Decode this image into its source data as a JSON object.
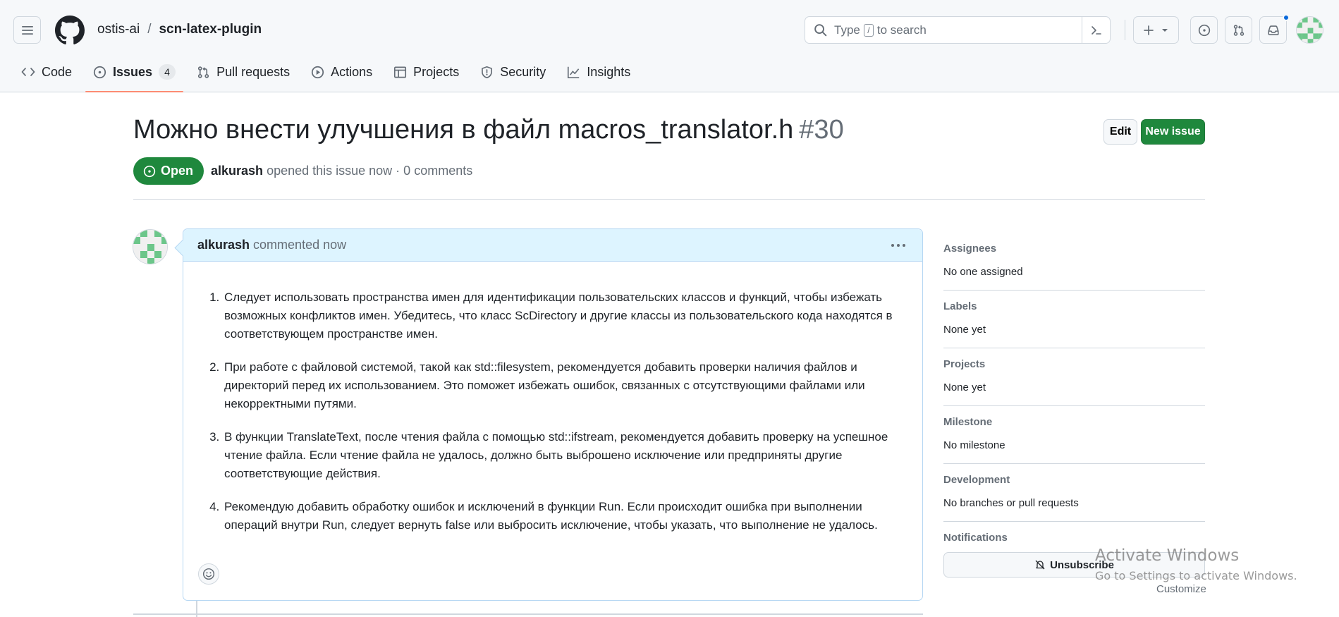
{
  "header": {
    "owner": "ostis-ai",
    "separator": "/",
    "repo": "scn-latex-plugin",
    "search_prefix": "Type",
    "search_key": "/",
    "search_suffix": "to search"
  },
  "repo_nav": {
    "tabs": [
      {
        "label": "Code",
        "icon": "code-icon"
      },
      {
        "label": "Issues",
        "icon": "issue-opened-icon",
        "count": "4",
        "selected": true
      },
      {
        "label": "Pull requests",
        "icon": "git-pull-request-icon"
      },
      {
        "label": "Actions",
        "icon": "play-icon"
      },
      {
        "label": "Projects",
        "icon": "table-icon"
      },
      {
        "label": "Security",
        "icon": "shield-icon"
      },
      {
        "label": "Insights",
        "icon": "graph-icon"
      }
    ]
  },
  "issue": {
    "title": "Можно внести улучшения в файл macros_translator.h",
    "number": "#30",
    "edit_label": "Edit",
    "new_issue_label": "New issue",
    "state": "Open",
    "author": "alkurash",
    "meta_text": "opened this issue now · 0 comments"
  },
  "comment": {
    "author": "alkurash",
    "action": "commented now",
    "items": [
      "Следует использовать пространства имен для идентификации пользовательских классов и функций, чтобы избежать возможных конфликтов имен. Убедитесь, что класс ScDirectory и другие классы из пользовательского кода находятся в соответствующем пространстве имен.",
      "При работе с файловой системой, такой как std::filesystem, рекомендуется добавить проверки наличия файлов и директорий перед их использованием. Это поможет избежать ошибок, связанных с отсутствующими файлами или некорректными путями.",
      "В функции TranslateText, после чтения файла с помощью std::ifstream, рекомендуется добавить проверку на успешное чтение файла. Если чтение файла не удалось, должно быть выброшено исключение или предприняты другие соответствующие действия.",
      "Рекомендую добавить обработку ошибок и исключений в функции Run. Если происходит ошибка при выполнении операций внутри Run, следует вернуть false или выбросить исключение, чтобы указать, что выполнение не удалось."
    ]
  },
  "sidebar": {
    "sections": [
      {
        "heading": "Assignees",
        "value": "No one assigned"
      },
      {
        "heading": "Labels",
        "value": "None yet"
      },
      {
        "heading": "Projects",
        "value": "None yet"
      },
      {
        "heading": "Milestone",
        "value": "No milestone"
      },
      {
        "heading": "Development",
        "value": "No branches or pull requests"
      }
    ],
    "notifications_heading": "Notifications",
    "customize_label": "Customize",
    "unsubscribe_label": "Unsubscribe"
  },
  "watermark": {
    "line1": "Activate Windows",
    "line2": "Go to Settings to activate Windows."
  },
  "colors": {
    "accent_green": "#1f883d",
    "tab_underline": "#fd8c73",
    "comment_header_bg": "#ddf4ff"
  }
}
